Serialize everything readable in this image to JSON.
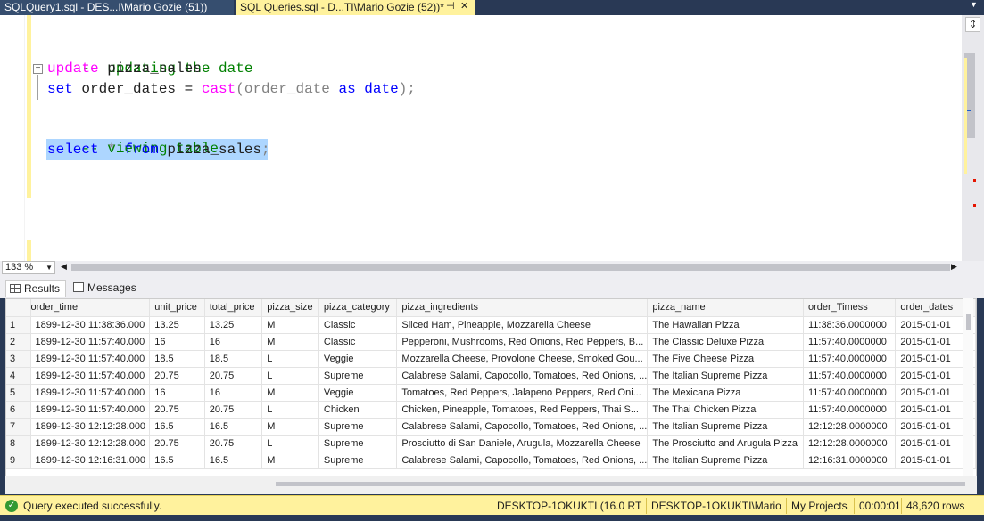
{
  "tabs": [
    {
      "label": "SQLQuery1.sql - DES...I\\Mario Gozie (51))"
    },
    {
      "label": "SQL Queries.sql - D...TI\\Mario Gozie (52))*"
    }
  ],
  "tab_controls": {
    "pin": "⊣",
    "close": "✕"
  },
  "editor": {
    "line1_comment": "-- updating the date",
    "line2_kw": "update",
    "line2_rest": " pizza_sales",
    "line3_kw": "set",
    "line3_a": " order_dates = ",
    "line3_fn": "cast",
    "line3_b": "(order_date ",
    "line3_as": "as",
    "line3_sp": " ",
    "line3_type": "date",
    "line3_c": ");",
    "line4_comment": "-- viewing table",
    "line5_select": "select",
    "line5_star": " * ",
    "line5_from": "from",
    "line5_table": " pizza_sales",
    "line5_semi": ";"
  },
  "zoom": {
    "value": "133 %"
  },
  "result_tabs": {
    "results": "Results",
    "messages": "Messages"
  },
  "grid": {
    "columns": [
      "",
      "order_time",
      "unit_price",
      "total_price",
      "pizza_size",
      "pizza_category",
      "pizza_ingredients",
      "pizza_name",
      "order_Timess",
      "order_dates"
    ],
    "rows": [
      [
        "1",
        "1899-12-30 11:38:36.000",
        "13.25",
        "13.25",
        "M",
        "Classic",
        "Sliced Ham, Pineapple, Mozzarella Cheese",
        "The Hawaiian Pizza",
        "11:38:36.0000000",
        "2015-01-01"
      ],
      [
        "2",
        "1899-12-30 11:57:40.000",
        "16",
        "16",
        "M",
        "Classic",
        "Pepperoni, Mushrooms, Red Onions, Red Peppers, B...",
        "The Classic Deluxe Pizza",
        "11:57:40.0000000",
        "2015-01-01"
      ],
      [
        "3",
        "1899-12-30 11:57:40.000",
        "18.5",
        "18.5",
        "L",
        "Veggie",
        "Mozzarella Cheese, Provolone Cheese, Smoked Gou...",
        "The Five Cheese Pizza",
        "11:57:40.0000000",
        "2015-01-01"
      ],
      [
        "4",
        "1899-12-30 11:57:40.000",
        "20.75",
        "20.75",
        "L",
        "Supreme",
        "Calabrese Salami, Capocollo, Tomatoes, Red Onions, ...",
        "The Italian Supreme Pizza",
        "11:57:40.0000000",
        "2015-01-01"
      ],
      [
        "5",
        "1899-12-30 11:57:40.000",
        "16",
        "16",
        "M",
        "Veggie",
        "Tomatoes, Red Peppers, Jalapeno Peppers, Red Oni...",
        "The Mexicana Pizza",
        "11:57:40.0000000",
        "2015-01-01"
      ],
      [
        "6",
        "1899-12-30 11:57:40.000",
        "20.75",
        "20.75",
        "L",
        "Chicken",
        "Chicken, Pineapple, Tomatoes, Red Peppers, Thai S...",
        "The Thai Chicken Pizza",
        "11:57:40.0000000",
        "2015-01-01"
      ],
      [
        "7",
        "1899-12-30 12:12:28.000",
        "16.5",
        "16.5",
        "M",
        "Supreme",
        "Calabrese Salami, Capocollo, Tomatoes, Red Onions, ...",
        "The Italian Supreme Pizza",
        "12:12:28.0000000",
        "2015-01-01"
      ],
      [
        "8",
        "1899-12-30 12:12:28.000",
        "20.75",
        "20.75",
        "L",
        "Supreme",
        "Prosciutto di San Daniele, Arugula, Mozzarella Cheese",
        "The Prosciutto and Arugula Pizza",
        "12:12:28.0000000",
        "2015-01-01"
      ],
      [
        "9",
        "1899-12-30 12:16:31.000",
        "16.5",
        "16.5",
        "M",
        "Supreme",
        "Calabrese Salami, Capocollo, Tomatoes, Red Onions, ...",
        "The Italian Supreme Pizza",
        "12:16:31.0000000",
        "2015-01-01"
      ]
    ]
  },
  "status": {
    "message": "Query executed successfully.",
    "server": "DESKTOP-1OKUKTI (16.0 RTM)",
    "user": "DESKTOP-1OKUKTI\\Mario ...",
    "database": "My Projects",
    "time": "00:00:01",
    "rows": "48,620 rows"
  },
  "colors": {
    "accent_yellow": "#fff29d",
    "dark_frame": "#293955",
    "selection": "#add6ff"
  }
}
